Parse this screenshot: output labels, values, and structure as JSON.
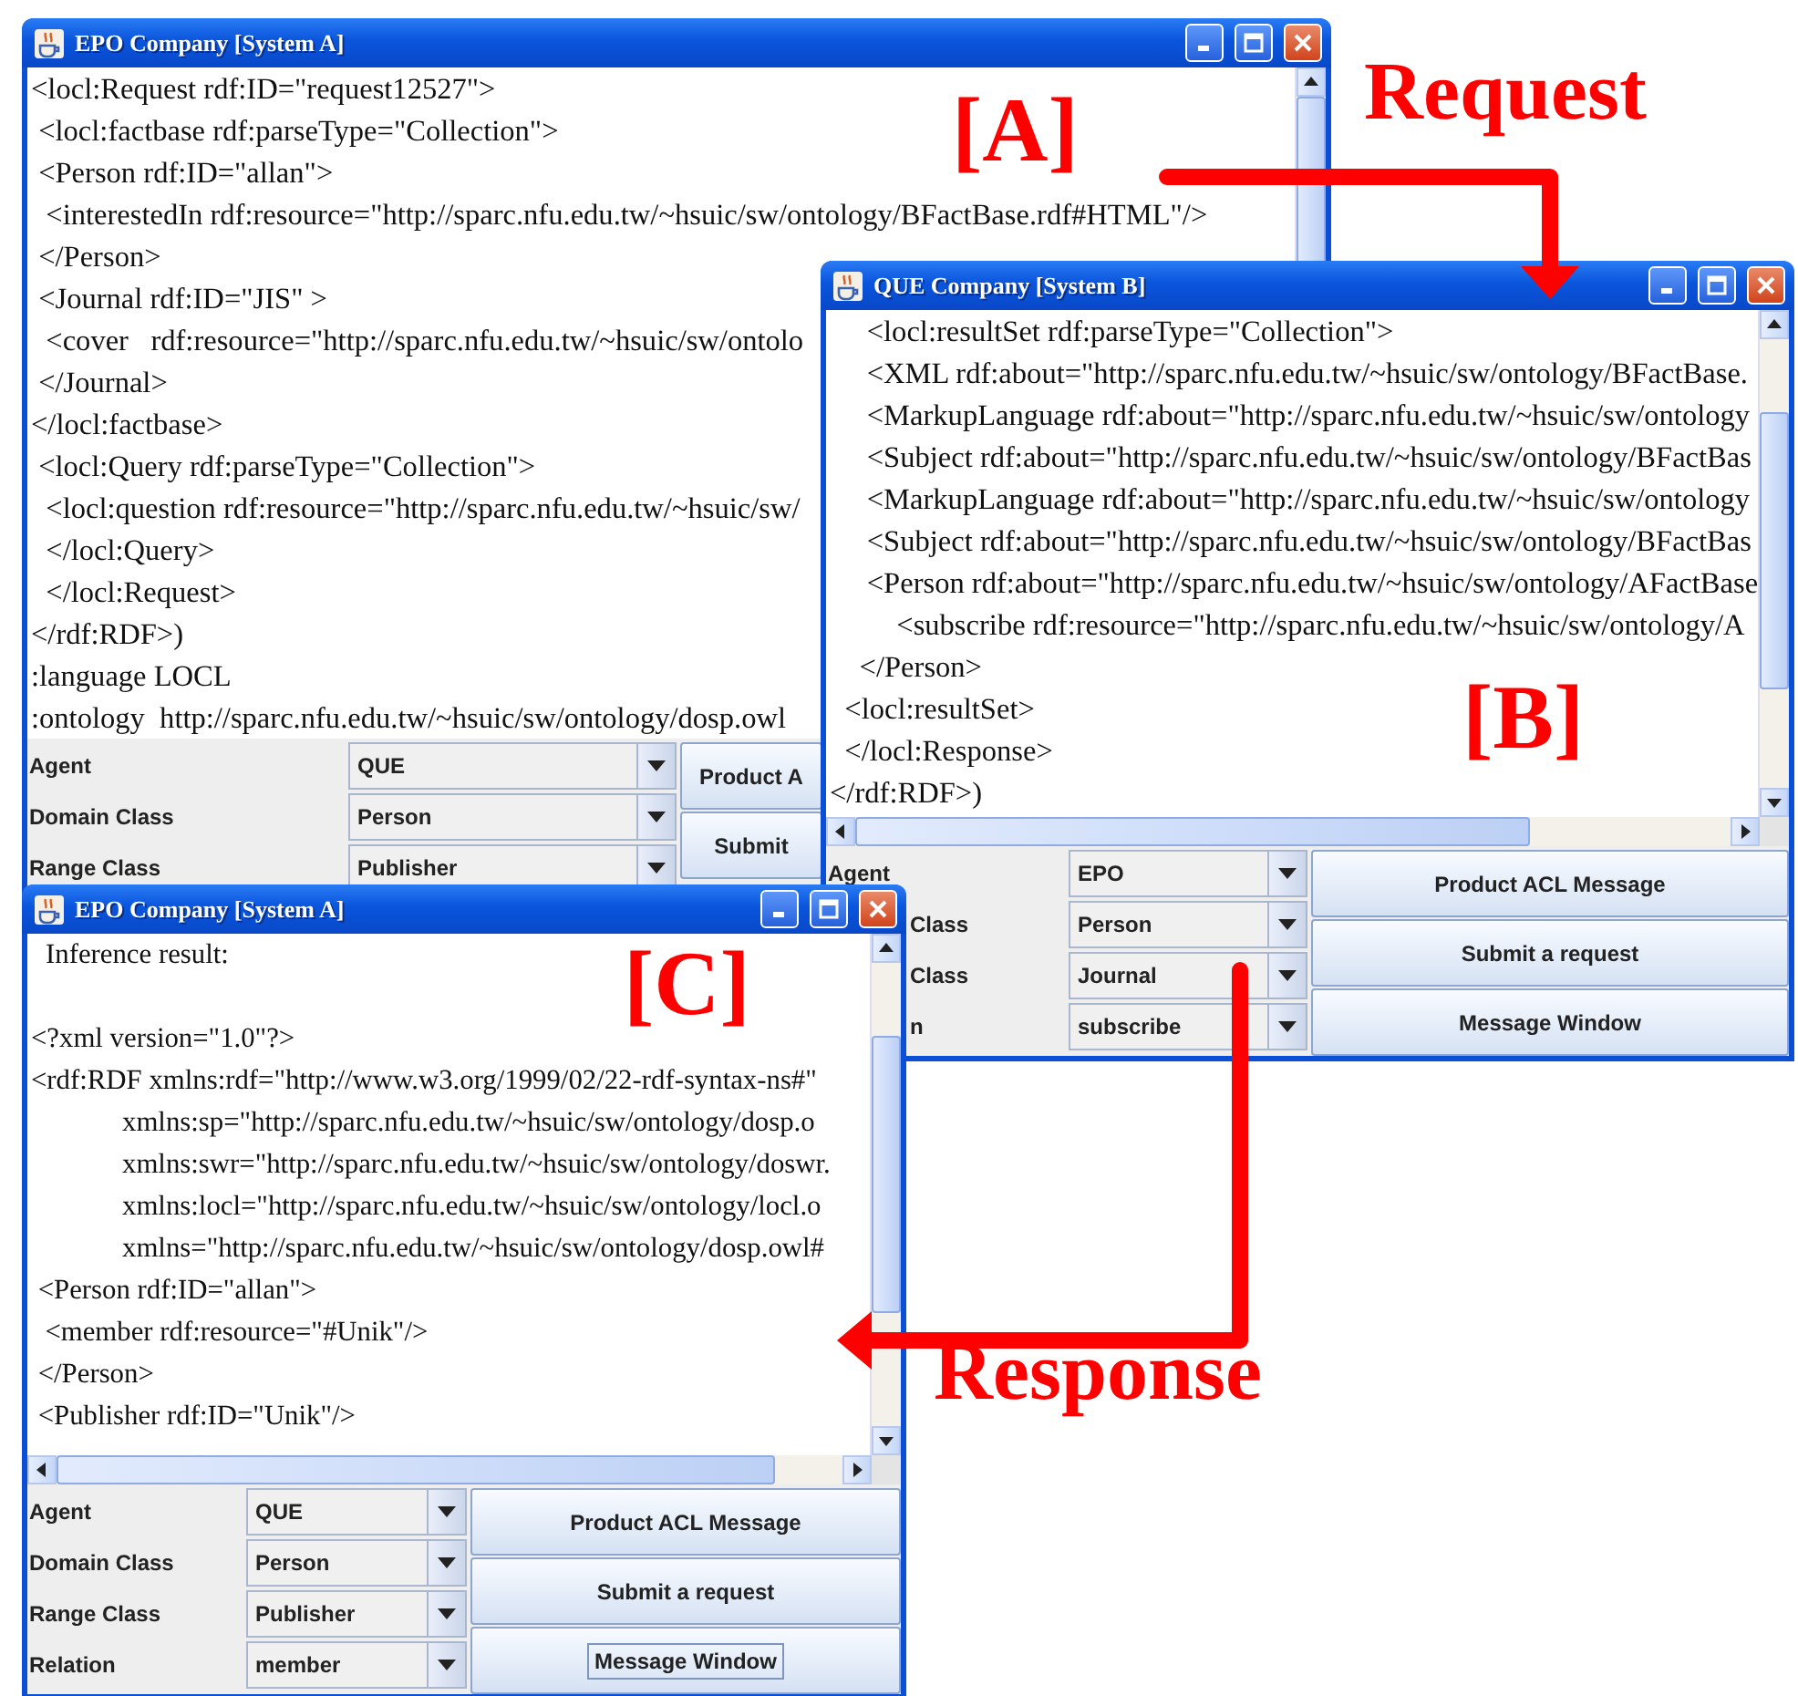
{
  "windows": [
    {
      "title": "EPO Company [System A]",
      "lines": [
        "<locl:Request rdf:ID=\"request12527\">",
        " <locl:factbase rdf:parseType=\"Collection\">",
        " <Person rdf:ID=\"allan\">",
        "  <interestedIn rdf:resource=\"http://sparc.nfu.edu.tw/~hsuic/sw/ontology/BFactBase.rdf#HTML\"/>",
        " </Person>",
        " <Journal rdf:ID=\"JIS\" >",
        "  <cover   rdf:resource=\"http://sparc.nfu.edu.tw/~hsuic/sw/ontolo",
        " </Journal>",
        "</locl:factbase>",
        " <locl:Query rdf:parseType=\"Collection\">",
        "  <locl:question rdf:resource=\"http://sparc.nfu.edu.tw/~hsuic/sw/",
        "  </locl:Query>",
        "  </locl:Request>",
        "</rdf:RDF>)",
        ":language LOCL",
        ":ontology  http://sparc.nfu.edu.tw/~hsuic/sw/ontology/dosp.owl"
      ],
      "form": {
        "rows": [
          {
            "label": "Agent",
            "covered": false,
            "value": "QUE"
          },
          {
            "label": "Domain Class",
            "covered": false,
            "value": "Person"
          },
          {
            "label": "Range Class",
            "covered": false,
            "value": "Publisher"
          }
        ],
        "buttons": [
          {
            "label": "Product A",
            "focused": false
          },
          {
            "label": "Submit",
            "focused": false
          }
        ]
      }
    },
    {
      "title": "QUE Company [System B]",
      "lines": [
        "     <locl:resultSet rdf:parseType=\"Collection\">",
        "     <XML rdf:about=\"http://sparc.nfu.edu.tw/~hsuic/sw/ontology/BFactBase.",
        "     <MarkupLanguage rdf:about=\"http://sparc.nfu.edu.tw/~hsuic/sw/ontology",
        "     <Subject rdf:about=\"http://sparc.nfu.edu.tw/~hsuic/sw/ontology/BFactBas",
        "     <MarkupLanguage rdf:about=\"http://sparc.nfu.edu.tw/~hsuic/sw/ontology",
        "     <Subject rdf:about=\"http://sparc.nfu.edu.tw/~hsuic/sw/ontology/BFactBas",
        "     <Person rdf:about=\"http://sparc.nfu.edu.tw/~hsuic/sw/ontology/AFactBase",
        "         <subscribe rdf:resource=\"http://sparc.nfu.edu.tw/~hsuic/sw/ontology/A",
        "    </Person>",
        "  <locl:resultSet>",
        "  </locl:Response>",
        "</rdf:RDF>)"
      ],
      "form": {
        "rows": [
          {
            "label": "Agent",
            "covered": false,
            "value": "EPO"
          },
          {
            "label": "Class",
            "covered": true,
            "value": "Person"
          },
          {
            "label": "Class",
            "covered": true,
            "value": "Journal"
          },
          {
            "label": "n",
            "covered": true,
            "value": "subscribe"
          }
        ],
        "buttons": [
          {
            "label": "Product ACL Message",
            "focused": false
          },
          {
            "label": "Submit a request",
            "focused": false
          },
          {
            "label": "Message Window",
            "focused": false
          }
        ]
      }
    },
    {
      "title": "EPO Company [System A]",
      "heading": "Inference result:",
      "lines": [
        "<?xml version=\"1.0\"?>",
        "<rdf:RDF xmlns:rdf=\"http://www.w3.org/1999/02/22-rdf-syntax-ns#\"",
        "             xmlns:sp=\"http://sparc.nfu.edu.tw/~hsuic/sw/ontology/dosp.o",
        "             xmlns:swr=\"http://sparc.nfu.edu.tw/~hsuic/sw/ontology/doswr.",
        "             xmlns:locl=\"http://sparc.nfu.edu.tw/~hsuic/sw/ontology/locl.o",
        "             xmlns=\"http://sparc.nfu.edu.tw/~hsuic/sw/ontology/dosp.owl#",
        " <Person rdf:ID=\"allan\">",
        "  <member rdf:resource=\"#Unik\"/>",
        " </Person>",
        " <Publisher rdf:ID=\"Unik\"/>"
      ],
      "form": {
        "rows": [
          {
            "label": "Agent",
            "covered": false,
            "value": "QUE"
          },
          {
            "label": "Domain Class",
            "covered": false,
            "value": "Person"
          },
          {
            "label": "Range Class",
            "covered": false,
            "value": "Publisher"
          },
          {
            "label": "Relation",
            "covered": false,
            "value": "member"
          }
        ],
        "buttons": [
          {
            "label": "Product ACL Message",
            "focused": false
          },
          {
            "label": "Submit a request",
            "focused": false
          },
          {
            "label": "Message Window",
            "focused": true
          }
        ]
      }
    }
  ],
  "annotations": [
    {
      "kind": "tag",
      "text": "[A]"
    },
    {
      "kind": "caption",
      "text": "Request"
    },
    {
      "kind": "tag",
      "text": "[B]"
    },
    {
      "kind": "tag",
      "text": "[C]"
    },
    {
      "kind": "caption",
      "text": "Response"
    }
  ]
}
